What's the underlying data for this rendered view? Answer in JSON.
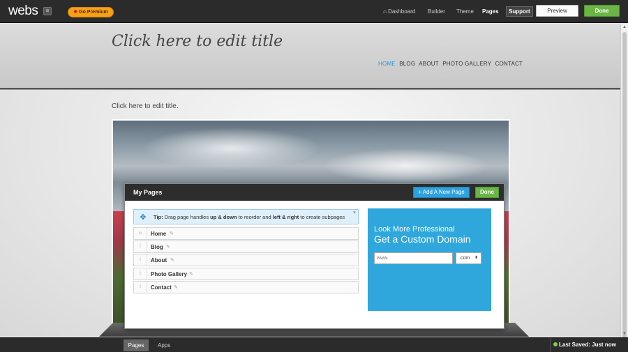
{
  "topbar": {
    "logo": "webs",
    "premium_label": "Go Premium",
    "nav": {
      "dashboard": "Dashboard",
      "builder": "Builder",
      "theme": "Theme",
      "pages": "Pages",
      "support": "Support"
    },
    "preview_label": "Preview",
    "done_label": "Done"
  },
  "site": {
    "title": "Click here to edit title",
    "nav": [
      "HOME",
      "BLOG",
      "ABOUT",
      "PHOTO GALLERY",
      "CONTACT"
    ],
    "subtitle": "Click here to edit title."
  },
  "modal": {
    "title": "My Pages",
    "add_page_label": "+ Add A New Page",
    "done_label": "Done",
    "tip": {
      "prefix": "Tip:",
      "text_1": " Drag page handles ",
      "bold_1": "up & down",
      "text_2": " to reorder and ",
      "bold_2": "left & right",
      "text_3": " to create subpages",
      "close": "×"
    },
    "pages": [
      {
        "name": "Home",
        "icon": "home-icon"
      },
      {
        "name": "Blog",
        "icon": "drag-handle-icon"
      },
      {
        "name": "About",
        "icon": "drag-handle-icon"
      },
      {
        "name": "Photo Gallery",
        "icon": "drag-handle-icon"
      },
      {
        "name": "Contact",
        "icon": "drag-handle-icon"
      }
    ],
    "promo": {
      "line1": "Look More Professional",
      "line2": "Get a Custom Domain",
      "input_placeholder": "www.",
      "tld_selected": ".com"
    }
  },
  "bottombar": {
    "tabs": [
      "Pages",
      "Apps"
    ],
    "save_status": "Last Saved: Just now"
  },
  "colors": {
    "accent_blue": "#2fa7dc",
    "done_green": "#6ab545",
    "premium_orange": "#f6a11a",
    "topbar": "#2b2b2b"
  }
}
